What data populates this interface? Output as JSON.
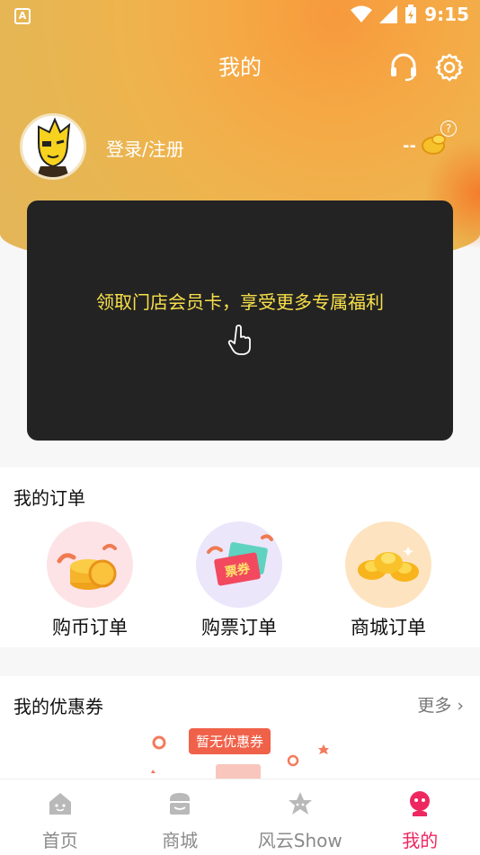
{
  "statusbar": {
    "left_badge": "A",
    "time": "9:15"
  },
  "header": {
    "title": "我的"
  },
  "profile": {
    "login_text": "登录/注册",
    "coin_value": "--",
    "help_symbol": "?"
  },
  "member_card": {
    "text": "领取门店会员卡，享受更多专属福利"
  },
  "orders": {
    "title": "我的订单",
    "items": [
      {
        "label": "购币订单",
        "icon": "coins-icon"
      },
      {
        "label": "购票订单",
        "icon": "ticket-icon",
        "badge": "票券"
      },
      {
        "label": "商城订单",
        "icon": "gold-ingot-icon"
      }
    ]
  },
  "coupons": {
    "title": "我的优惠券",
    "more": "更多",
    "empty_text": "暂无优惠券"
  },
  "nav": {
    "items": [
      {
        "label": "首页",
        "icon": "home-icon"
      },
      {
        "label": "商城",
        "icon": "shop-icon"
      },
      {
        "label": "风云Show",
        "icon": "star-icon"
      },
      {
        "label": "我的",
        "icon": "profile-icon",
        "active": true
      }
    ]
  },
  "colors": {
    "accent": "#ee2760",
    "card_text": "#f8e04a",
    "card_bg": "#232323"
  }
}
